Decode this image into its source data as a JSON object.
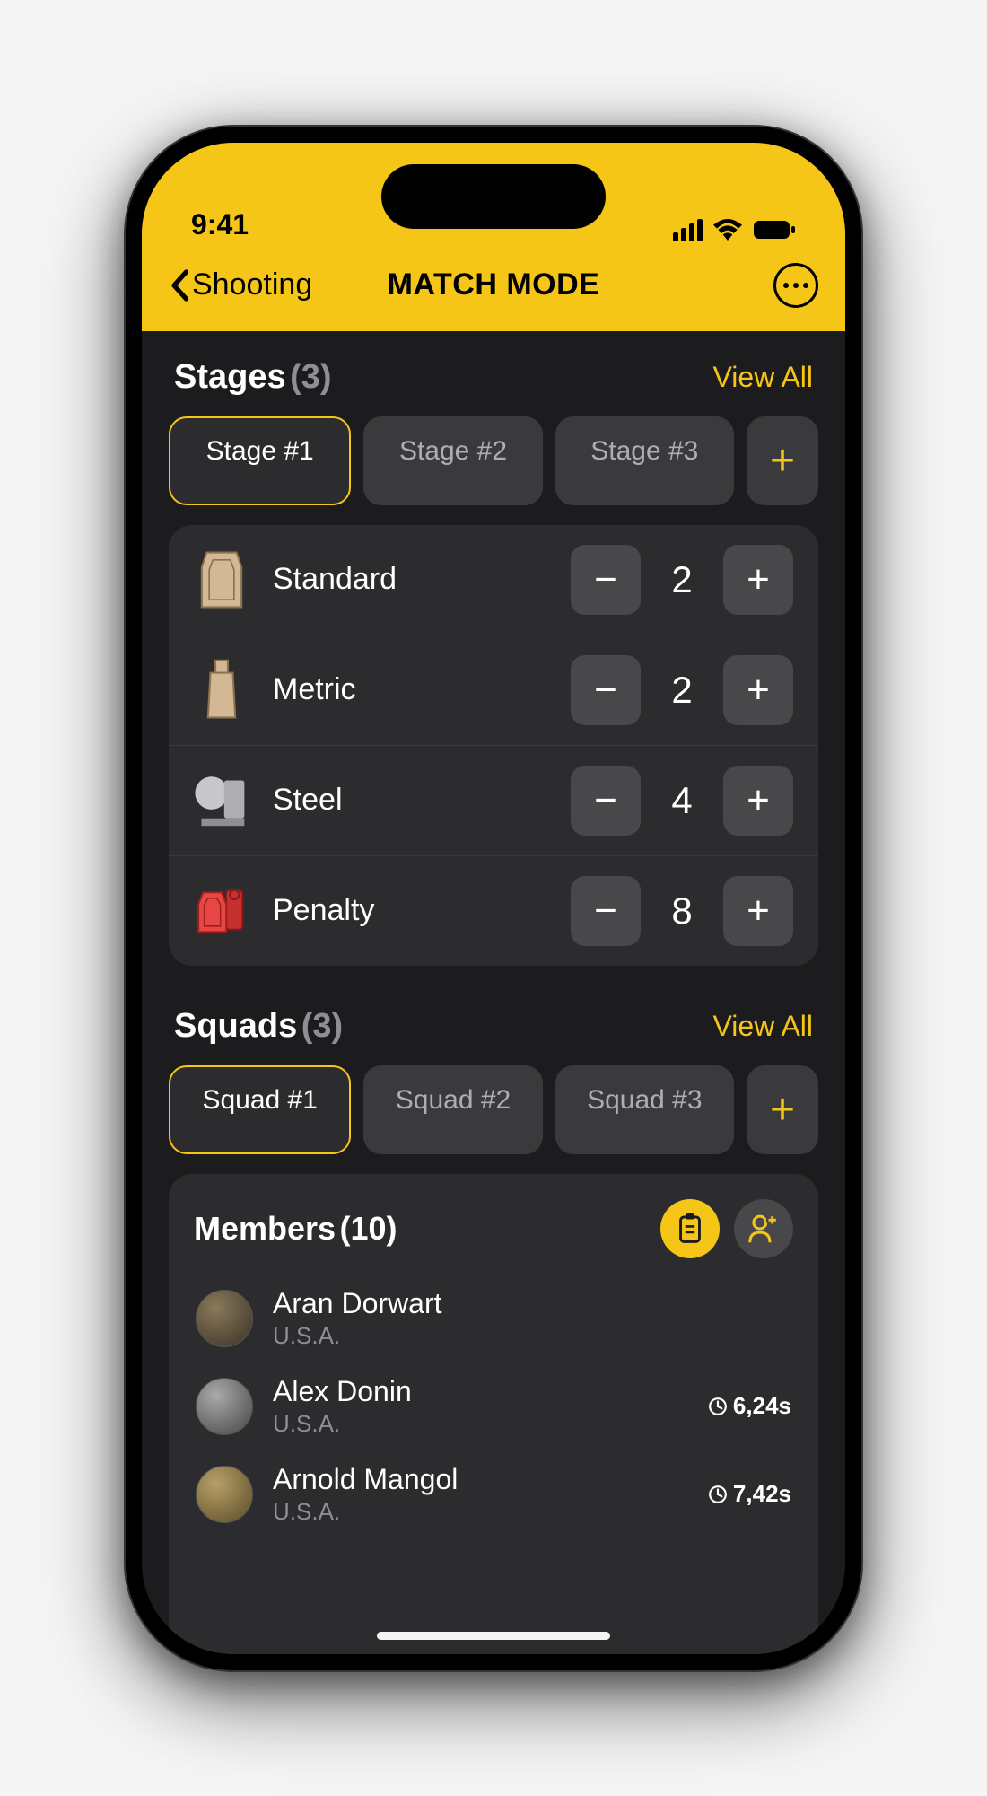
{
  "status": {
    "time": "9:41"
  },
  "nav": {
    "back_label": "Shooting",
    "title": "MATCH MODE"
  },
  "stages": {
    "title": "Stages",
    "count": "(3)",
    "view_all": "View All",
    "tabs": [
      "Stage #1",
      "Stage #2",
      "Stage #3"
    ],
    "targets": [
      {
        "label": "Standard",
        "value": "2"
      },
      {
        "label": "Metric",
        "value": "2"
      },
      {
        "label": "Steel",
        "value": "4"
      },
      {
        "label": "Penalty",
        "value": "8"
      }
    ]
  },
  "squads": {
    "title": "Squads",
    "count": "(3)",
    "view_all": "View All",
    "tabs": [
      "Squad #1",
      "Squad #2",
      "Squad #3"
    ]
  },
  "members": {
    "title": "Members",
    "count": "(10)",
    "list": [
      {
        "name": "Aran Dorwart",
        "country": "U.S.A.",
        "time": ""
      },
      {
        "name": "Alex Donin",
        "country": "U.S.A.",
        "time": "6,24s"
      },
      {
        "name": "Arnold Mangol",
        "country": "U.S.A.",
        "time": "7,42s"
      }
    ]
  }
}
